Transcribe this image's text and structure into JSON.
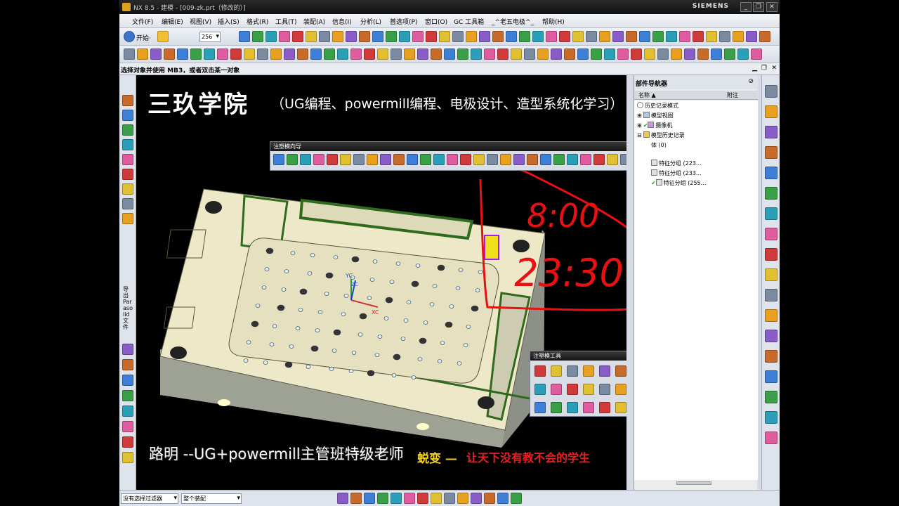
{
  "window": {
    "title": "NX 8.5 - 建模 - [009-zk.prt（修改的）]",
    "brand": "SIEMENS",
    "minimize": "_",
    "restore": "❐",
    "close": "✕"
  },
  "menu": {
    "items": [
      "文件(F)",
      "编辑(E)",
      "视图(V)",
      "插入(S)",
      "格式(R)",
      "工具(T)",
      "装配(A)",
      "信息(I)",
      "分析(L)",
      "首选项(P)",
      "窗口(O)",
      "GC 工具箱",
      "_^老五电极^_",
      "帮助(H)"
    ]
  },
  "toolbar": {
    "start_label": "开始·",
    "value_combo": "256"
  },
  "prompt": {
    "message": "选择对象并使用 MB3，或者双击某一对象"
  },
  "left_resource": {
    "vertical_text": "导出 Parasolid 文件"
  },
  "graphics": {
    "banner_title": "三玖学院",
    "banner_subtitle": "（UG编程、powermill编程、电极设计、造型系统化学习）",
    "teacher": "路明 --UG+powermill主管班特级老师",
    "slogan_name": "蜕变 —",
    "slogan_text": "让天下没有教不会的学生",
    "handwriting_1": "8:00",
    "handwriting_2": "23:30",
    "axis_yc": "YC",
    "axis_xc": "XC",
    "axis_zc": "ZC",
    "colors": {
      "plate": "#ece8c8",
      "plate_side": "#a8aa9c",
      "edge": "#2f6a1f",
      "annotation": "#e81010"
    }
  },
  "mold_nav": {
    "title": "注塑模向导"
  },
  "mold_tools": {
    "title": "注塑模工具"
  },
  "navigator": {
    "title": "部件导航器",
    "col_name": "名称 ▲",
    "col_note": "附注",
    "tree": [
      {
        "label": "历史记录模式",
        "indent": 0
      },
      {
        "label": "模型视图",
        "indent": 0
      },
      {
        "label": "摄像机",
        "indent": 0
      },
      {
        "label": "模型历史记录",
        "indent": 0
      },
      {
        "label": "体 (0)",
        "indent": 3
      },
      {
        "label": "特征分组 (223...",
        "indent": 3
      },
      {
        "label": "特征分组 (233...",
        "indent": 3
      },
      {
        "label": "特征分组 (255...",
        "indent": 3
      }
    ]
  },
  "status": {
    "filter_combo": "没有选择过滤器",
    "scope_combo": "整个装配"
  }
}
